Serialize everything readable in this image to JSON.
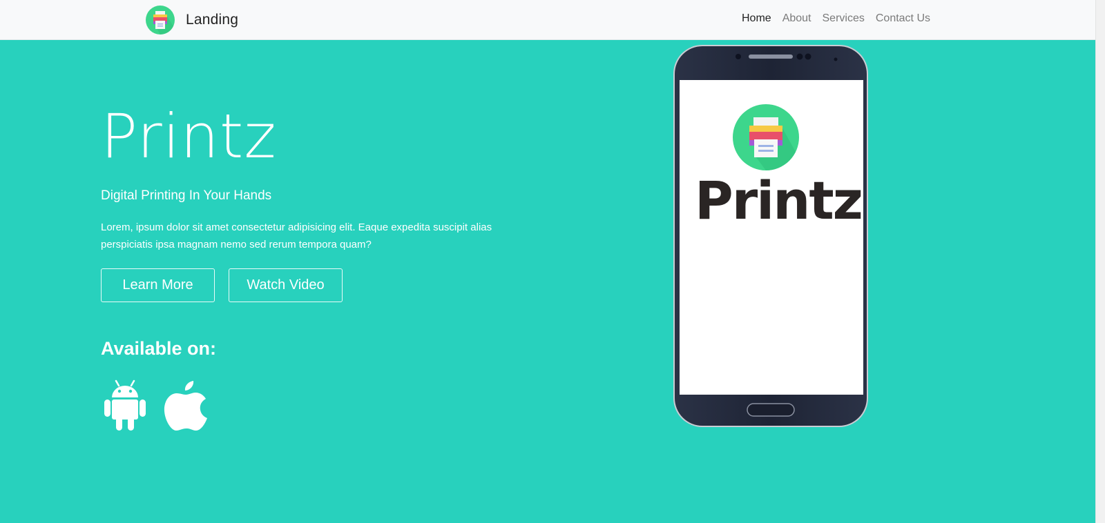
{
  "navbar": {
    "brand": "Landing",
    "links": [
      {
        "label": "Home",
        "active": true
      },
      {
        "label": "About",
        "active": false
      },
      {
        "label": "Services",
        "active": false
      },
      {
        "label": "Contact Us",
        "active": false
      }
    ]
  },
  "hero": {
    "title": "Printz",
    "subtitle": "Digital Printing In Your Hands",
    "description": "Lorem, ipsum dolor sit amet consectetur adipisicing elit. Eaque expedita suscipit alias perspiciatis ipsa magnam nemo sed rerum tempora quam?",
    "buttons": {
      "learn_more": "Learn More",
      "watch_video": "Watch Video"
    },
    "available_title": "Available on:",
    "platform_icons": [
      "android-icon",
      "apple-icon"
    ]
  },
  "phone": {
    "screen_wordmark": "Printz"
  },
  "colors": {
    "hero_bg": "#28d1bd",
    "navbar_bg": "#f8f9fa",
    "logo_green": "#3dd68c"
  }
}
